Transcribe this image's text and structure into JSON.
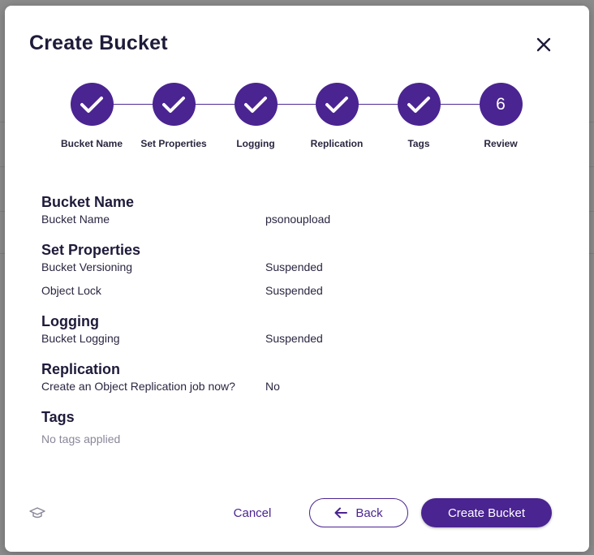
{
  "modal": {
    "title": "Create Bucket"
  },
  "steps": [
    {
      "label": "Bucket Name",
      "status": "complete",
      "icon": "check-icon"
    },
    {
      "label": "Set Properties",
      "status": "complete",
      "icon": "check-icon"
    },
    {
      "label": "Logging",
      "status": "complete",
      "icon": "check-icon"
    },
    {
      "label": "Replication",
      "status": "complete",
      "icon": "check-icon"
    },
    {
      "label": "Tags",
      "status": "complete",
      "icon": "check-icon"
    },
    {
      "label": "Review",
      "status": "current",
      "number": "6"
    }
  ],
  "review": {
    "bucket_name": {
      "title": "Bucket Name",
      "rows": [
        {
          "key": "Bucket Name",
          "value": "psonoupload"
        }
      ]
    },
    "set_properties": {
      "title": "Set Properties",
      "rows": [
        {
          "key": "Bucket Versioning",
          "value": "Suspended"
        },
        {
          "key": "Object Lock",
          "value": "Suspended"
        }
      ]
    },
    "logging": {
      "title": "Logging",
      "rows": [
        {
          "key": "Bucket Logging",
          "value": "Suspended"
        }
      ]
    },
    "replication": {
      "title": "Replication",
      "rows": [
        {
          "key": "Create an Object Replication job now?",
          "value": "No"
        }
      ]
    },
    "tags": {
      "title": "Tags",
      "empty_text": "No tags applied"
    }
  },
  "footer": {
    "help_icon": "graduation-cap-icon",
    "cancel_label": "Cancel",
    "back_label": "Back",
    "create_label": "Create Bucket"
  },
  "colors": {
    "accent": "#4a2491",
    "title": "#1e1b3a",
    "muted": "#8a8799"
  }
}
